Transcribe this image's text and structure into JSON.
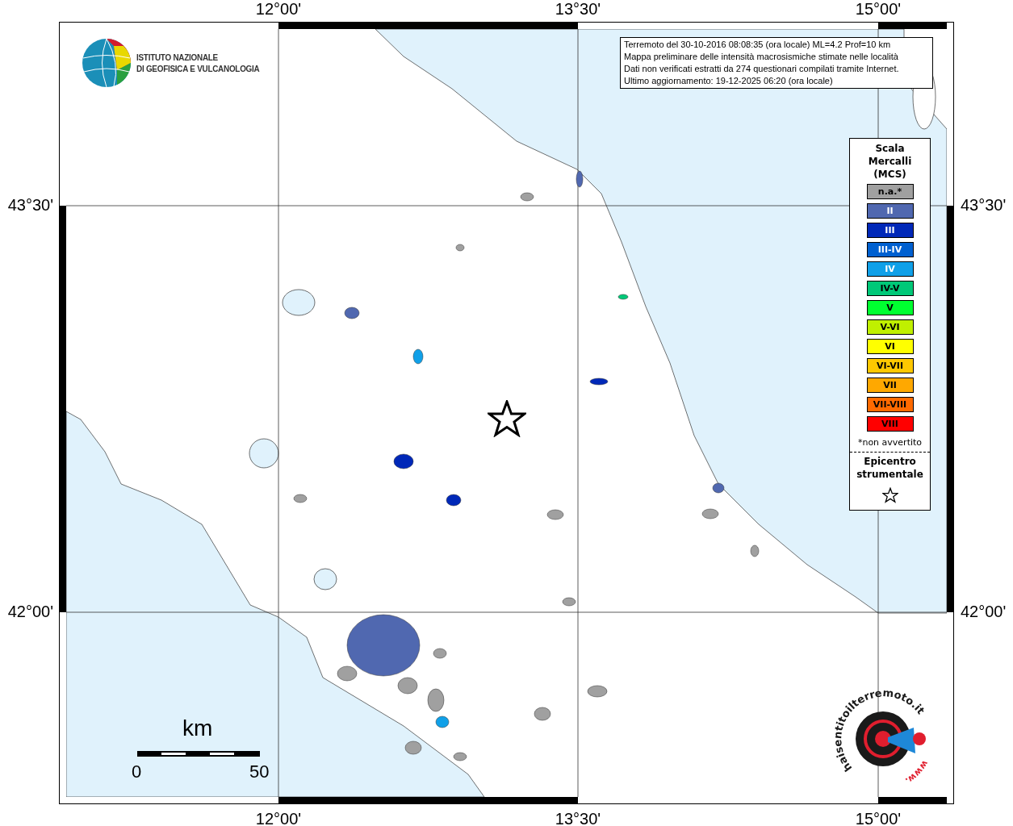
{
  "axis_labels": {
    "top": [
      "12°00'",
      "13°30'",
      "15°00'"
    ],
    "bottom": [
      "12°00'",
      "13°30'",
      "15°00'"
    ],
    "left": [
      "43°30'",
      "42°00'"
    ],
    "right": [
      "43°30'",
      "42°00'"
    ]
  },
  "institute_logo": {
    "lines": [
      "ISTITUTO NAZIONALE",
      "DI GEOFISICA E VULCANOLOGIA"
    ]
  },
  "info_box": {
    "lines": [
      "Terremoto del 30-10-2016 08:08:35 (ora locale) ML=4.2 Prof=10 km",
      "Mappa preliminare delle intensità macrosismiche stimate nelle località",
      "Dati non verificati estratti da 274 questionari compilati tramite Internet.",
      "Ultimo aggiornamento: 19-12-2025 06:20 (ora locale)"
    ]
  },
  "legend": {
    "title_lines": [
      "Scala",
      "Mercalli",
      "(MCS)"
    ],
    "items": [
      {
        "label": "n.a.*",
        "color": "#a0a0a0"
      },
      {
        "label": "II",
        "color": "#5068b0"
      },
      {
        "label": "III",
        "color": "#0028b8"
      },
      {
        "label": "III-IV",
        "color": "#0060d0"
      },
      {
        "label": "IV",
        "color": "#10a0e8"
      },
      {
        "label": "IV-V",
        "color": "#00c878"
      },
      {
        "label": "V",
        "color": "#00ff30"
      },
      {
        "label": "V-VI",
        "color": "#c0f000"
      },
      {
        "label": "VI",
        "color": "#ffff00"
      },
      {
        "label": "VI-VII",
        "color": "#ffc800"
      },
      {
        "label": "VII",
        "color": "#ffa800"
      },
      {
        "label": "VII-VIII",
        "color": "#ff6a00"
      },
      {
        "label": "VIII",
        "color": "#ff0000"
      }
    ],
    "note": "*non avvertito",
    "epicenter_lines": [
      "Epicentro",
      "strumentale"
    ]
  },
  "scale_bar": {
    "unit": "km",
    "labels": [
      "0",
      "50"
    ]
  },
  "site_logo": {
    "arc_text": "haisentitoilterremoto.it",
    "url_prefix": "www."
  }
}
